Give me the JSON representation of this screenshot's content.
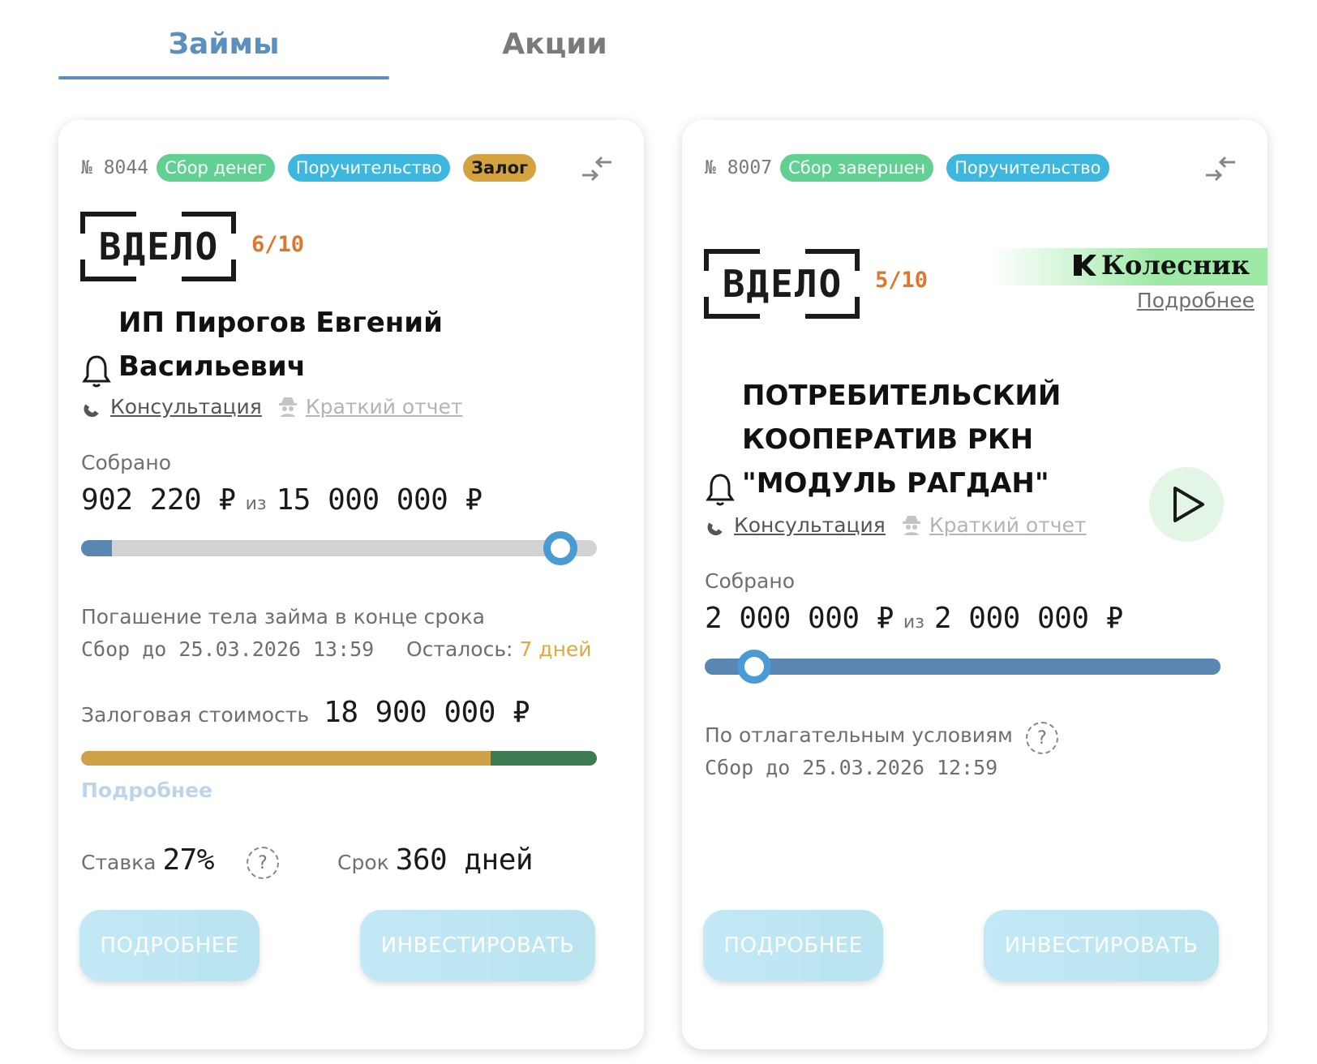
{
  "tabs": [
    {
      "label": "Займы",
      "active": true
    },
    {
      "label": "Акции",
      "active": false
    }
  ],
  "colors": {
    "accent": "#5c8fbd",
    "badge_green": "#62cf93",
    "badge_blue": "#3eb7de",
    "badge_gold": "#d4a23f",
    "rating_orange": "#e0762c",
    "progress_fill": "#5a87b2",
    "collateral_gold": "#cfa24a",
    "collateral_green": "#3d7b53",
    "partner_green": "#9ee9a6"
  },
  "cards": [
    {
      "number": "№ 8044",
      "badges": [
        "Сбор денег",
        "Поручительство",
        "Залог"
      ],
      "logo_text": "ВДЕЛО",
      "rating": "6/10",
      "name_line1": "ИП Пирогов Евгений",
      "name_line2": "Васильевич",
      "consult_label": "Консультация",
      "report_label": "Краткий отчет",
      "collected_label": "Собрано",
      "collected": "902 220 ₽",
      "of_label": "из",
      "target": "15 000 000 ₽",
      "progress_fraction": 0.06,
      "repayment": "Погашение тела займа в конце срока",
      "deadline": "Сбор до 25.03.2026 13:59",
      "remaining_label": "Осталось:",
      "remaining_value": "7 дней",
      "collateral_label": "Залоговая стоимость",
      "collateral_value": "18 900 000 ₽",
      "more_link": "Подробнее",
      "rate_label": "Ставка",
      "rate_value": "27%",
      "term_label": "Срок",
      "term_value": "360 дней",
      "btn_details": "ПОДРОБНЕЕ",
      "btn_invest": "ИНВЕСТИРОВАТЬ"
    },
    {
      "number": "№ 8007",
      "badges": [
        "Сбор завершен",
        "Поручительство"
      ],
      "logo_text": "ВДЕЛО",
      "rating": "5/10",
      "partner_name": "Колесник",
      "partner_more": "Подробнее",
      "name_line1": "ПОТРЕБИТЕЛЬСКИЙ",
      "name_line2": "КООПЕРАТИВ РКН",
      "name_line3": "\"МОДУЛЬ РАГДАН\"",
      "consult_label": "Консультация",
      "report_label": "Краткий отчет",
      "collected_label": "Собрано",
      "collected": "2 000 000 ₽",
      "of_label": "из",
      "target": "2 000 000 ₽",
      "progress_fraction": 1.0,
      "conditions": "По отлагательным условиям",
      "deadline": "Сбор до 25.03.2026 12:59",
      "btn_details": "ПОДРОБНЕЕ",
      "btn_invest": "ИНВЕСТИРОВАТЬ"
    }
  ],
  "icons": {
    "compare": "compare-arrows-icon",
    "bell": "bell-icon",
    "phone": "phone-icon",
    "report": "spy-icon",
    "help": "question-icon",
    "play": "play-icon",
    "partner_logo": "k-logo-icon"
  }
}
